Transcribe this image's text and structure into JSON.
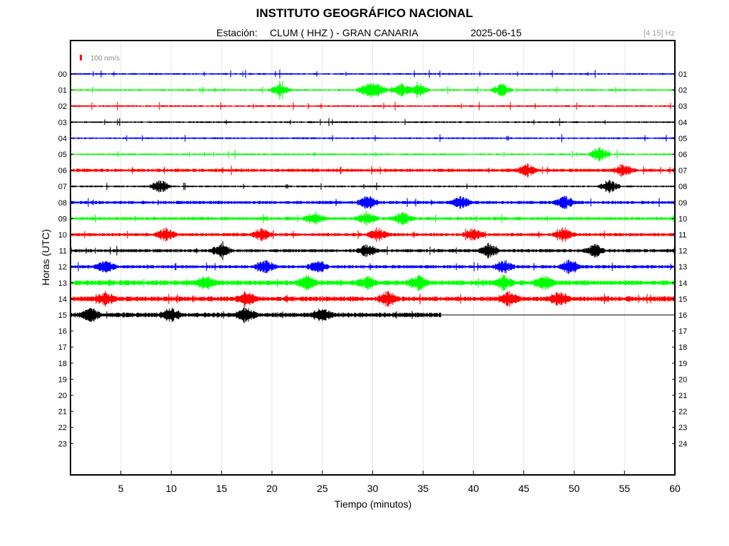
{
  "chart_data": {
    "type": "line",
    "title": "INSTITUTO GEOGRÁFICO NACIONAL",
    "station_label": "Estación:",
    "station": "CLUM ( HHZ ) - GRAN CANARIA",
    "date": "2025-06-15",
    "frequency_band": "[4 15] Hz",
    "scale_label": "100 nm/s",
    "xlabel": "Tiempo (minutos)",
    "ylabel": "Horas (UTC)",
    "xlim": [
      0,
      60
    ],
    "x_ticks": [
      5,
      10,
      15,
      20,
      25,
      30,
      35,
      40,
      45,
      50,
      55,
      60
    ],
    "grid": true,
    "left_hour_labels": [
      "00",
      "01",
      "02",
      "03",
      "04",
      "05",
      "06",
      "07",
      "08",
      "09",
      "10",
      "11",
      "12",
      "13",
      "14",
      "15",
      "16",
      "17",
      "18",
      "19",
      "20",
      "21",
      "22",
      "23"
    ],
    "right_hour_labels": [
      "01",
      "02",
      "03",
      "04",
      "05",
      "06",
      "07",
      "08",
      "09",
      "10",
      "11",
      "12",
      "13",
      "14",
      "15",
      "16",
      "17",
      "18",
      "19",
      "20",
      "21",
      "22",
      "23",
      "24"
    ],
    "trace_colors": [
      "#0000ff",
      "#00ff00",
      "#ff0000",
      "#000000"
    ],
    "traces": [
      {
        "hour": "00",
        "color": "#0000ff",
        "end_minute": 60,
        "amplitude": "low",
        "events": []
      },
      {
        "hour": "01",
        "color": "#00ff00",
        "end_minute": 60,
        "amplitude": "low",
        "events": [
          20.8,
          29.5,
          30.5,
          32.8,
          34.5,
          42.8
        ]
      },
      {
        "hour": "02",
        "color": "#ff0000",
        "end_minute": 60,
        "amplitude": "low",
        "events": []
      },
      {
        "hour": "03",
        "color": "#000000",
        "end_minute": 60,
        "amplitude": "low",
        "events": []
      },
      {
        "hour": "04",
        "color": "#0000ff",
        "end_minute": 60,
        "amplitude": "low",
        "events": []
      },
      {
        "hour": "05",
        "color": "#00ff00",
        "end_minute": 60,
        "amplitude": "low",
        "events": [
          52.5
        ]
      },
      {
        "hour": "06",
        "color": "#ff0000",
        "end_minute": 60,
        "amplitude": "medium",
        "events": [
          45.3,
          54.9
        ]
      },
      {
        "hour": "07",
        "color": "#000000",
        "end_minute": 60,
        "amplitude": "low",
        "events": [
          8.9,
          53.5
        ]
      },
      {
        "hour": "08",
        "color": "#0000ff",
        "end_minute": 60,
        "amplitude": "medium",
        "events": [
          29.5,
          38.8,
          49.0
        ]
      },
      {
        "hour": "09",
        "color": "#00ff00",
        "end_minute": 60,
        "amplitude": "medium",
        "events": [
          24.1,
          29.4,
          33.0
        ]
      },
      {
        "hour": "10",
        "color": "#ff0000",
        "end_minute": 60,
        "amplitude": "medium",
        "events": [
          9.5,
          19.0,
          30.5,
          40.0,
          49.0
        ]
      },
      {
        "hour": "11",
        "color": "#000000",
        "end_minute": 60,
        "amplitude": "medium",
        "events": [
          15.0,
          29.5,
          41.5,
          52.0
        ]
      },
      {
        "hour": "12",
        "color": "#0000ff",
        "end_minute": 60,
        "amplitude": "medium",
        "events": [
          3.5,
          19.3,
          24.5,
          43.0,
          49.5
        ]
      },
      {
        "hour": "13",
        "color": "#00ff00",
        "end_minute": 60,
        "amplitude": "high",
        "events": [
          13.5,
          23.5,
          29.5,
          34.5,
          43.0,
          47.0
        ]
      },
      {
        "hour": "14",
        "color": "#ff0000",
        "end_minute": 60,
        "amplitude": "high",
        "events": [
          3.5,
          17.5,
          31.5,
          43.5,
          48.5
        ]
      },
      {
        "hour": "15",
        "color": "#000000",
        "end_minute": 36.8,
        "amplitude": "high",
        "events": [
          2.0,
          10.0,
          17.5,
          25.0
        ]
      }
    ]
  }
}
